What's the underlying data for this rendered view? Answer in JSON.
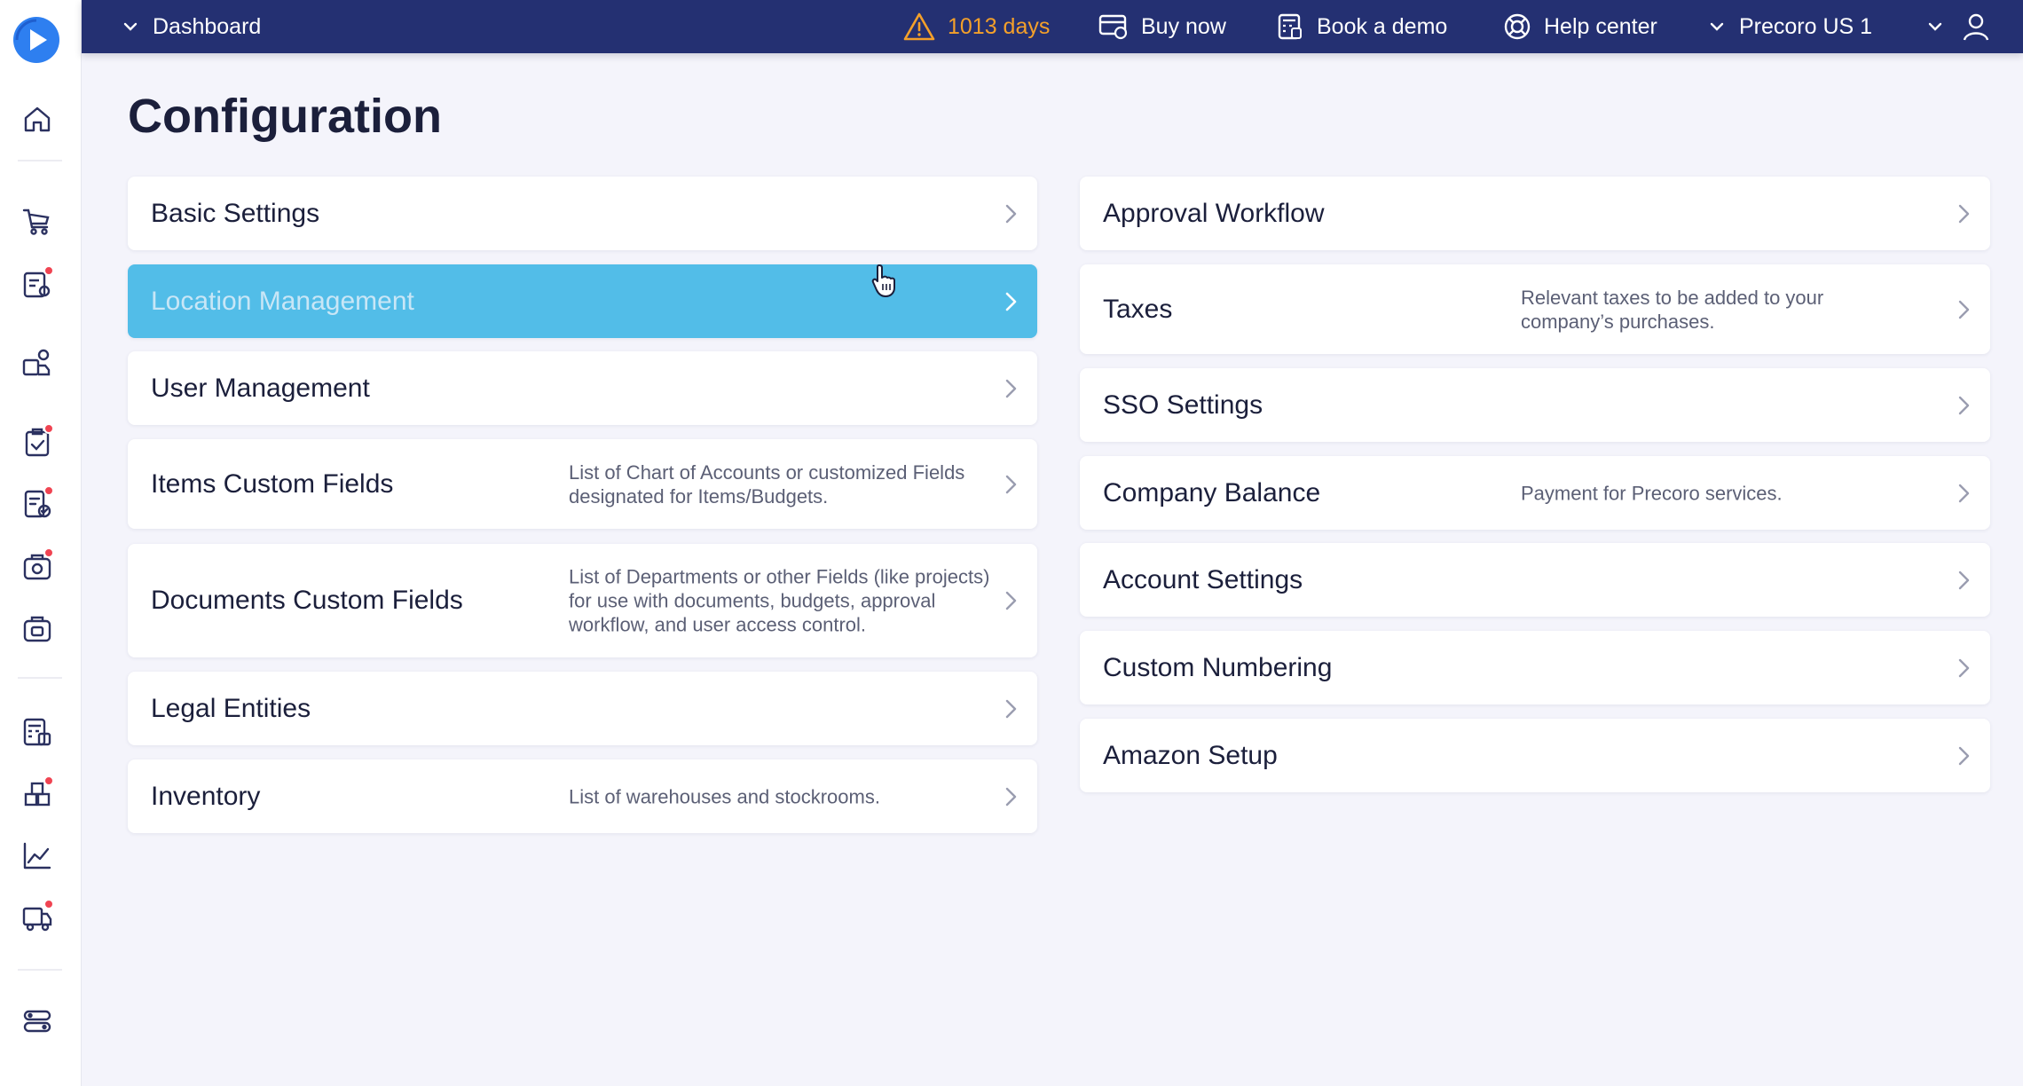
{
  "topbar": {
    "dashboard_label": "Dashboard",
    "trial_days": "1013 days",
    "buy_now": "Buy now",
    "book_demo": "Book a demo",
    "help_center": "Help center",
    "company": "Precoro US 1"
  },
  "page": {
    "title": "Configuration"
  },
  "left_cards": [
    {
      "title": "Basic Settings",
      "desc": ""
    },
    {
      "title": "Location Management",
      "desc": ""
    },
    {
      "title": "User Management",
      "desc": ""
    },
    {
      "title": "Items Custom Fields",
      "desc": "List of Chart of Accounts or customized Fields designated for Items/Budgets."
    },
    {
      "title": "Documents Custom Fields",
      "desc": "List of Departments or other Fields (like projects) for use with documents, budgets, approval workflow, and user access control."
    },
    {
      "title": "Legal Entities",
      "desc": ""
    },
    {
      "title": "Inventory",
      "desc": "List of warehouses and stockrooms."
    }
  ],
  "right_cards": [
    {
      "title": "Approval Workflow",
      "desc": ""
    },
    {
      "title": "Taxes",
      "desc": "Relevant taxes to be added to your company’s purchases."
    },
    {
      "title": "SSO Settings",
      "desc": ""
    },
    {
      "title": "Company Balance",
      "desc": "Payment for Precoro services."
    },
    {
      "title": "Account Settings",
      "desc": ""
    },
    {
      "title": "Custom Numbering",
      "desc": ""
    },
    {
      "title": "Amazon Setup",
      "desc": ""
    }
  ],
  "colors": {
    "topbar": "#243072",
    "accent": "#52bde8",
    "warning": "#f4a02a",
    "notification": "#f04452"
  },
  "icons": {
    "sidebar": [
      "home-icon",
      "cart-icon",
      "requests-icon",
      "suppliers-icon",
      "approvals-icon",
      "invoices-icon",
      "receipts-icon",
      "payments-icon",
      "budgets-icon",
      "inventory-icon",
      "analytics-icon",
      "delivery-icon",
      "settings-icon"
    ]
  }
}
